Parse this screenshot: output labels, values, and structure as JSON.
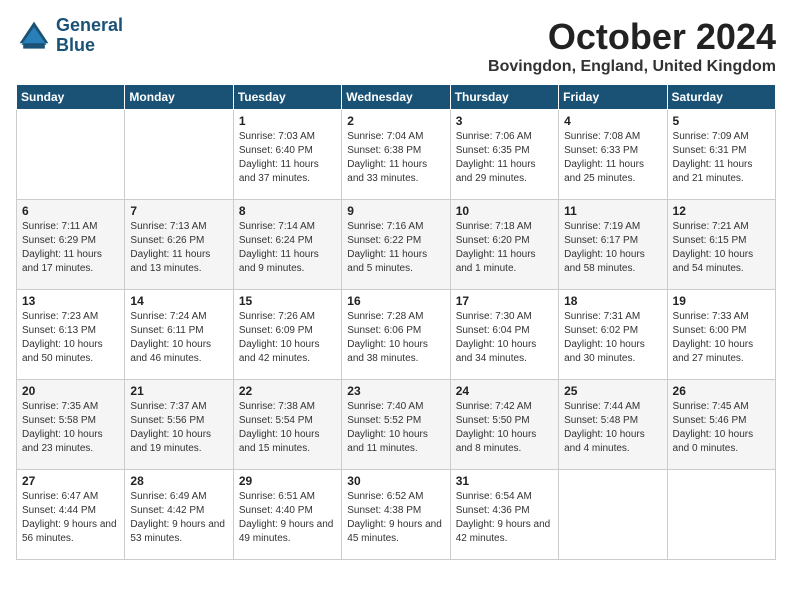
{
  "header": {
    "logo_line1": "General",
    "logo_line2": "Blue",
    "month": "October 2024",
    "location": "Bovingdon, England, United Kingdom"
  },
  "weekdays": [
    "Sunday",
    "Monday",
    "Tuesday",
    "Wednesday",
    "Thursday",
    "Friday",
    "Saturday"
  ],
  "weeks": [
    [
      {
        "day": "",
        "info": ""
      },
      {
        "day": "",
        "info": ""
      },
      {
        "day": "1",
        "info": "Sunrise: 7:03 AM\nSunset: 6:40 PM\nDaylight: 11 hours and 37 minutes."
      },
      {
        "day": "2",
        "info": "Sunrise: 7:04 AM\nSunset: 6:38 PM\nDaylight: 11 hours and 33 minutes."
      },
      {
        "day": "3",
        "info": "Sunrise: 7:06 AM\nSunset: 6:35 PM\nDaylight: 11 hours and 29 minutes."
      },
      {
        "day": "4",
        "info": "Sunrise: 7:08 AM\nSunset: 6:33 PM\nDaylight: 11 hours and 25 minutes."
      },
      {
        "day": "5",
        "info": "Sunrise: 7:09 AM\nSunset: 6:31 PM\nDaylight: 11 hours and 21 minutes."
      }
    ],
    [
      {
        "day": "6",
        "info": "Sunrise: 7:11 AM\nSunset: 6:29 PM\nDaylight: 11 hours and 17 minutes."
      },
      {
        "day": "7",
        "info": "Sunrise: 7:13 AM\nSunset: 6:26 PM\nDaylight: 11 hours and 13 minutes."
      },
      {
        "day": "8",
        "info": "Sunrise: 7:14 AM\nSunset: 6:24 PM\nDaylight: 11 hours and 9 minutes."
      },
      {
        "day": "9",
        "info": "Sunrise: 7:16 AM\nSunset: 6:22 PM\nDaylight: 11 hours and 5 minutes."
      },
      {
        "day": "10",
        "info": "Sunrise: 7:18 AM\nSunset: 6:20 PM\nDaylight: 11 hours and 1 minute."
      },
      {
        "day": "11",
        "info": "Sunrise: 7:19 AM\nSunset: 6:17 PM\nDaylight: 10 hours and 58 minutes."
      },
      {
        "day": "12",
        "info": "Sunrise: 7:21 AM\nSunset: 6:15 PM\nDaylight: 10 hours and 54 minutes."
      }
    ],
    [
      {
        "day": "13",
        "info": "Sunrise: 7:23 AM\nSunset: 6:13 PM\nDaylight: 10 hours and 50 minutes."
      },
      {
        "day": "14",
        "info": "Sunrise: 7:24 AM\nSunset: 6:11 PM\nDaylight: 10 hours and 46 minutes."
      },
      {
        "day": "15",
        "info": "Sunrise: 7:26 AM\nSunset: 6:09 PM\nDaylight: 10 hours and 42 minutes."
      },
      {
        "day": "16",
        "info": "Sunrise: 7:28 AM\nSunset: 6:06 PM\nDaylight: 10 hours and 38 minutes."
      },
      {
        "day": "17",
        "info": "Sunrise: 7:30 AM\nSunset: 6:04 PM\nDaylight: 10 hours and 34 minutes."
      },
      {
        "day": "18",
        "info": "Sunrise: 7:31 AM\nSunset: 6:02 PM\nDaylight: 10 hours and 30 minutes."
      },
      {
        "day": "19",
        "info": "Sunrise: 7:33 AM\nSunset: 6:00 PM\nDaylight: 10 hours and 27 minutes."
      }
    ],
    [
      {
        "day": "20",
        "info": "Sunrise: 7:35 AM\nSunset: 5:58 PM\nDaylight: 10 hours and 23 minutes."
      },
      {
        "day": "21",
        "info": "Sunrise: 7:37 AM\nSunset: 5:56 PM\nDaylight: 10 hours and 19 minutes."
      },
      {
        "day": "22",
        "info": "Sunrise: 7:38 AM\nSunset: 5:54 PM\nDaylight: 10 hours and 15 minutes."
      },
      {
        "day": "23",
        "info": "Sunrise: 7:40 AM\nSunset: 5:52 PM\nDaylight: 10 hours and 11 minutes."
      },
      {
        "day": "24",
        "info": "Sunrise: 7:42 AM\nSunset: 5:50 PM\nDaylight: 10 hours and 8 minutes."
      },
      {
        "day": "25",
        "info": "Sunrise: 7:44 AM\nSunset: 5:48 PM\nDaylight: 10 hours and 4 minutes."
      },
      {
        "day": "26",
        "info": "Sunrise: 7:45 AM\nSunset: 5:46 PM\nDaylight: 10 hours and 0 minutes."
      }
    ],
    [
      {
        "day": "27",
        "info": "Sunrise: 6:47 AM\nSunset: 4:44 PM\nDaylight: 9 hours and 56 minutes."
      },
      {
        "day": "28",
        "info": "Sunrise: 6:49 AM\nSunset: 4:42 PM\nDaylight: 9 hours and 53 minutes."
      },
      {
        "day": "29",
        "info": "Sunrise: 6:51 AM\nSunset: 4:40 PM\nDaylight: 9 hours and 49 minutes."
      },
      {
        "day": "30",
        "info": "Sunrise: 6:52 AM\nSunset: 4:38 PM\nDaylight: 9 hours and 45 minutes."
      },
      {
        "day": "31",
        "info": "Sunrise: 6:54 AM\nSunset: 4:36 PM\nDaylight: 9 hours and 42 minutes."
      },
      {
        "day": "",
        "info": ""
      },
      {
        "day": "",
        "info": ""
      }
    ]
  ]
}
